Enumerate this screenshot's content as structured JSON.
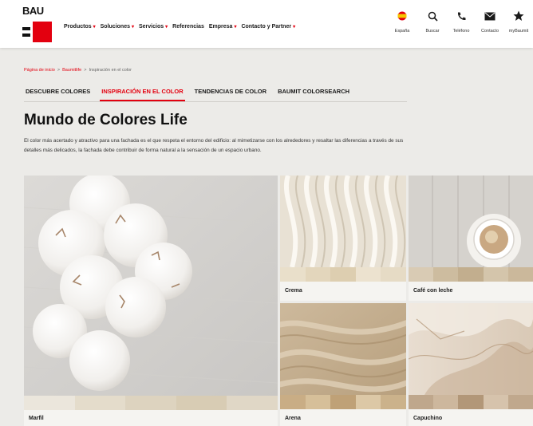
{
  "header": {
    "logo_text": "BAU",
    "nav": [
      {
        "label": "Productos",
        "has_menu": true
      },
      {
        "label": "Soluciones",
        "has_menu": true
      },
      {
        "label": "Servicios",
        "has_menu": true
      },
      {
        "label": "Referencias",
        "has_menu": false
      },
      {
        "label": "Empresa",
        "has_menu": true
      },
      {
        "label": "Contacto y Partner",
        "has_menu": true
      }
    ],
    "utilities": [
      {
        "label": "España",
        "icon": "spain-flag-icon"
      },
      {
        "label": "Buscar",
        "icon": "search-icon"
      },
      {
        "label": "Teléfono",
        "icon": "phone-icon"
      },
      {
        "label": "Contacto",
        "icon": "mail-icon"
      },
      {
        "label": "myBaumit",
        "icon": "star-icon"
      }
    ]
  },
  "breadcrumb": {
    "home": "Página de inicio",
    "sep1": ">",
    "section": "Baumitlife",
    "sep2": ">",
    "current": "Inspiración en el color"
  },
  "tabs": [
    {
      "label": "DESCUBRE COLORES",
      "active": false
    },
    {
      "label": "INSPIRACIÓN EN EL COLOR",
      "active": true
    },
    {
      "label": "TENDENCIAS DE COLOR",
      "active": false
    },
    {
      "label": "BAUMIT COLORSEARCH",
      "active": false
    }
  ],
  "main": {
    "title": "Mundo de Colores Life",
    "description": "El color más acertado y atractivo para una fachada es el que respeta el entorno del edificio: al mimetizarse con los alrededores y resaltar las diferencias a través de sus detalles más delicados, la fachada debe contribuir de forma natural a la sensación de un espacio urbano."
  },
  "tiles": [
    {
      "name": "Marfil",
      "swatches": [
        "#ebe6dc",
        "#e4dccb",
        "#ddd3bf",
        "#d8ccb4",
        "#e0d7c6"
      ]
    },
    {
      "name": "Crema",
      "swatches": [
        "#e9dfca",
        "#e3d6bc",
        "#ddceb0",
        "#ece2cf",
        "#e6dbc5"
      ]
    },
    {
      "name": "Café con leche",
      "swatches": [
        "#d9cbb4",
        "#cdbc9f",
        "#c2ae8e",
        "#d4c5ab",
        "#cbb89b"
      ]
    },
    {
      "name": "Arena",
      "swatches": [
        "#c9ad85",
        "#d6bf99",
        "#bfa177",
        "#dcc8a6",
        "#cbb28b"
      ]
    },
    {
      "name": "Capuchino",
      "swatches": [
        "#bfa78c",
        "#cdb79d",
        "#b29778",
        "#d6c3ac",
        "#c0a88d"
      ]
    }
  ]
}
